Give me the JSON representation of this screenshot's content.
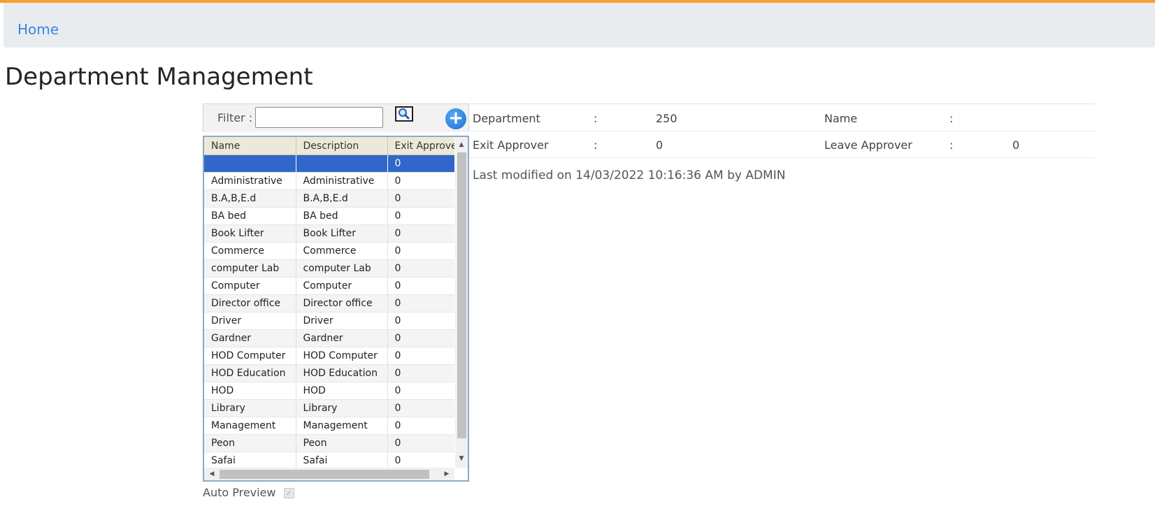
{
  "breadcrumb": {
    "home": "Home"
  },
  "page": {
    "title": "Department Management"
  },
  "filter": {
    "label": "Filter :",
    "value": ""
  },
  "grid": {
    "columns": [
      "Name",
      "Description",
      "Exit Approver"
    ],
    "rows": [
      [
        "",
        "",
        "0"
      ],
      [
        "Administrative",
        "Administrative",
        "0"
      ],
      [
        "B.A,B,E.d",
        "B.A,B,E.d",
        "0"
      ],
      [
        "BA bed",
        "BA bed",
        "0"
      ],
      [
        "Book Lifter",
        "Book Lifter",
        "0"
      ],
      [
        "Commerce",
        "Commerce",
        "0"
      ],
      [
        "computer Lab",
        "computer Lab",
        "0"
      ],
      [
        "Computer",
        "Computer",
        "0"
      ],
      [
        "Director office",
        "Director office",
        "0"
      ],
      [
        "Driver",
        "Driver",
        "0"
      ],
      [
        "Gardner",
        "Gardner",
        "0"
      ],
      [
        "HOD Computer",
        "HOD Computer",
        "0"
      ],
      [
        "HOD Education",
        "HOD Education",
        "0"
      ],
      [
        "HOD",
        "HOD",
        "0"
      ],
      [
        "Library",
        "Library",
        "0"
      ],
      [
        "Management",
        "Management",
        "0"
      ],
      [
        "Peon",
        "Peon",
        "0"
      ],
      [
        "Safai",
        "Safai",
        "0"
      ]
    ],
    "selected_row": 0
  },
  "auto_preview": {
    "label": "Auto Preview",
    "checked": true
  },
  "details": {
    "department_label": "Department",
    "department_sep": ":",
    "department_value": "250",
    "name_label": "Name",
    "name_sep": ":",
    "name_value": "",
    "exit_approver_label": "Exit Approver",
    "exit_approver_sep": ":",
    "exit_approver_value": "0",
    "leave_approver_label": "Leave Approver",
    "leave_approver_sep": ":",
    "leave_approver_value": "0"
  },
  "last_modified": "Last modified on 14/03/2022 10:16:36 AM by ADMIN",
  "colors": {
    "accent_strip": "#f7a030",
    "link": "#3a87e0",
    "selection": "#3167c9"
  }
}
